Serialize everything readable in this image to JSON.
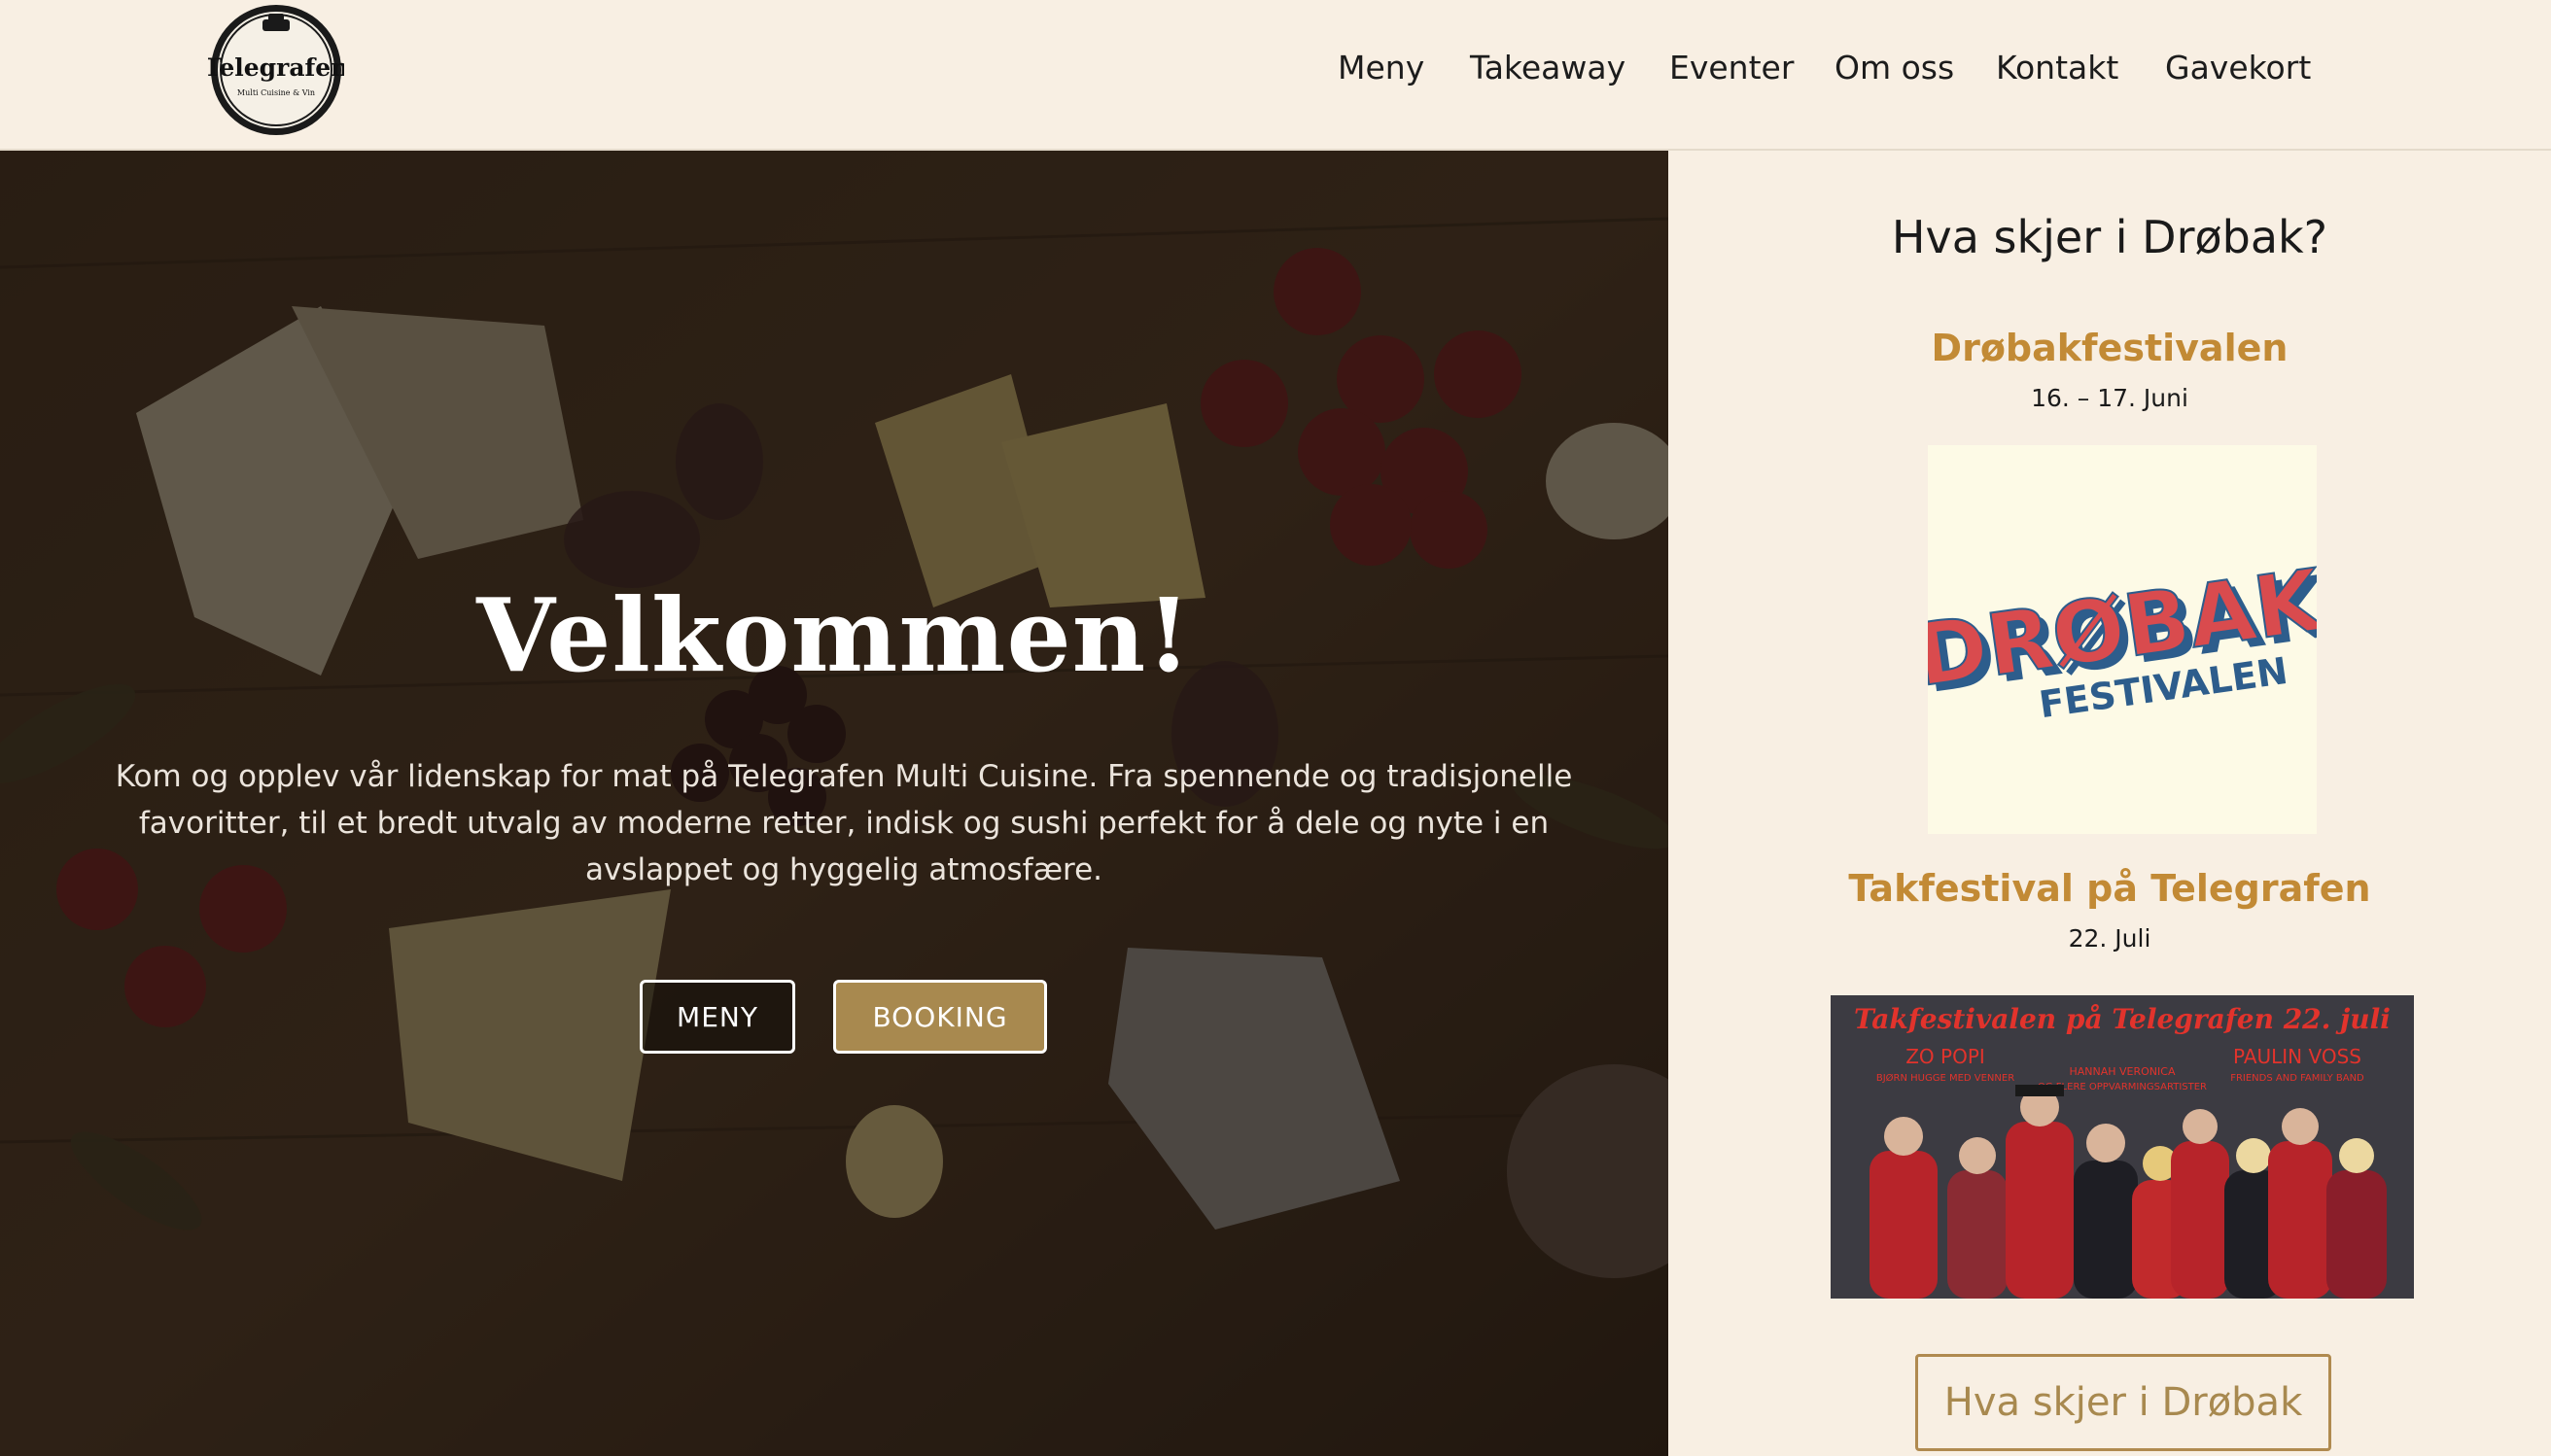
{
  "header": {
    "logo_text": "Telegrafen",
    "logo_subtext": "Multi Cuisine & Vin",
    "nav": [
      {
        "label": "Meny"
      },
      {
        "label": "Takeaway"
      },
      {
        "label": "Eventer"
      },
      {
        "label": "Om oss"
      },
      {
        "label": "Kontakt"
      },
      {
        "label": "Gavekort"
      }
    ]
  },
  "hero": {
    "title": "Velkommen!",
    "text": "Kom og opplev vår lidenskap for mat på Telegrafen Multi Cuisine. Fra spennende og tradisjonelle favoritter, til et bredt utvalg av moderne retter, indisk og sushi perfekt for å dele og nyte i en avslappet og hyggelig atmosfære.",
    "buttons": {
      "meny": "MENY",
      "booking": "BOOKING"
    }
  },
  "sidebar": {
    "title": "Hva skjer i Drøbak?",
    "events": [
      {
        "title": "Drøbakfestivalen",
        "date": "16. – 17. Juni",
        "poster_text_1": "DRØBAK",
        "poster_text_2": "FESTIVALEN"
      },
      {
        "title": "Takfestival på Telegrafen",
        "date": "22. Juli",
        "poster_text": "Takfestivalen på Telegrafen 22. juli",
        "poster_acts": [
          "ZO POPI",
          "BJØRN HUGGE MED VENNER",
          "HANNAH VERONICA",
          "OG FLERE OPPVARMINGSARTISTER",
          "PAULIN VOSS",
          "FRIENDS AND FAMILY BAND"
        ]
      }
    ],
    "button": "Hva skjer i Drøbak"
  },
  "colors": {
    "background": "#f8efe3",
    "accent_gold": "#a8894f",
    "event_title": "#c28a35",
    "hero_overlay": "#2d2118"
  }
}
